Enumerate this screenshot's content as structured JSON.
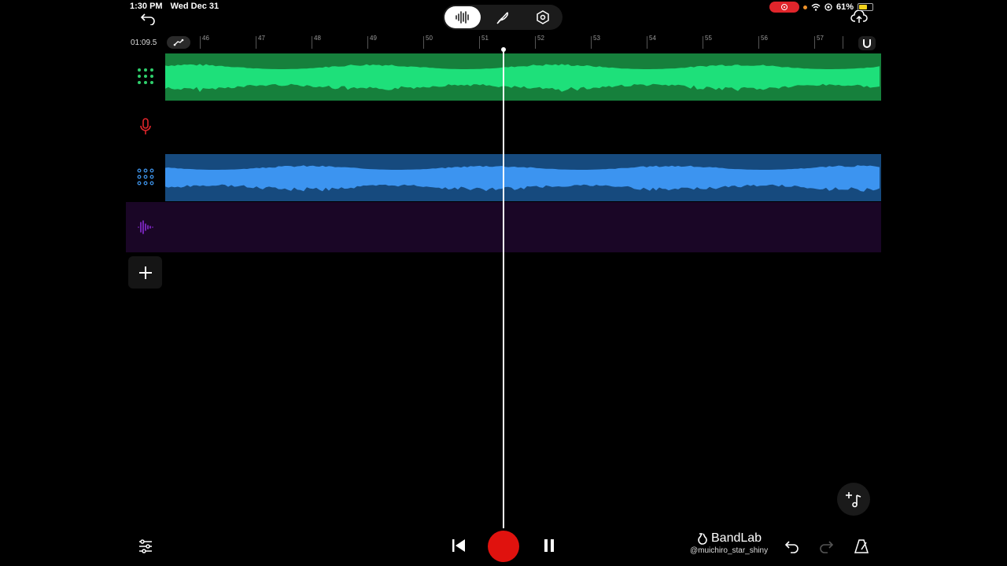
{
  "status_bar": {
    "time": "1:30 PM",
    "date": "Wed Dec 31",
    "battery": "61%"
  },
  "toolbar": {
    "tabs": [
      "waveform-view",
      "instruments",
      "settings"
    ]
  },
  "timeline": {
    "position": "01:09.5",
    "bars": [
      "46",
      "47",
      "48",
      "49",
      "50",
      "51",
      "52",
      "53",
      "54",
      "55",
      "56",
      "57"
    ]
  },
  "tracks": [
    {
      "type": "instrument",
      "color": "#2fcf6c",
      "region_bg": "#16803c",
      "wave": "#1ee07a"
    },
    {
      "type": "vocal",
      "color": "#e0252b"
    },
    {
      "type": "instrument",
      "color": "#3b8de0",
      "region_bg": "#164a7e",
      "wave": "#3c94f0"
    },
    {
      "type": "audio",
      "color": "#8a2bd6",
      "region_bg": "#1a0626"
    }
  ],
  "brand": {
    "name": "BandLab",
    "user": "@muichiro_star_shiny"
  },
  "colors": {
    "record": "#e0120e",
    "accent": "#ffffff"
  }
}
